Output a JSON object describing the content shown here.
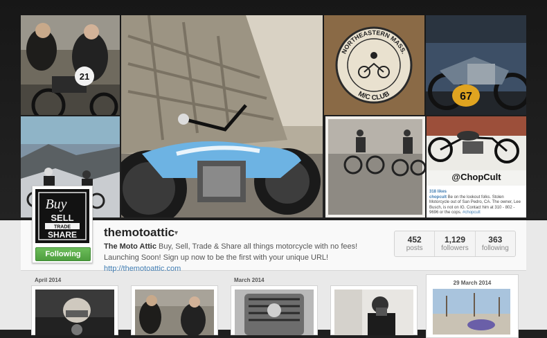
{
  "profile": {
    "username": "themotoattic",
    "display_name": "The Moto Attic",
    "bio": " Buy, Sell, Trade & Share all things motorcycle with no fees! Launching Soon! Sign up now to be the first with your unique URL! ",
    "url": "http://themotoattic.com",
    "follow_label": "Following",
    "avatar_text": {
      "buy": "Buy",
      "sell": "SELL",
      "trade": "TRADE",
      "share": "SHARE"
    }
  },
  "stats": [
    {
      "value": "452",
      "label": "posts"
    },
    {
      "value": "1,129",
      "label": "followers"
    },
    {
      "value": "363",
      "label": "following"
    }
  ],
  "cover": {
    "badge_text": {
      "top": "NORTHEASTERN MASS.",
      "bottom": "M/C CLUB"
    },
    "race_number_1": "21",
    "race_number_2": "67",
    "chopcult": {
      "handle_overlay": "@ChopCult",
      "likes": "318 likes",
      "user": "chopcult",
      "caption": " Be on the lookout folks. Stolen Motorcycle out of San Pedro, CA. The owner, Lee Busch, is not on IG. Contact him at 310 - 802 - 9696 or the cops. ",
      "hashtag": "#chopcult"
    }
  },
  "timeline": {
    "month_1": "April 2014",
    "month_2": "March 2014",
    "date_card": "29 March 2014"
  },
  "colors": {
    "follow_green": "#4e9e3f",
    "link_blue": "#3e7bb1",
    "background_dark": "#1f1f1f",
    "background_light": "#e9e9e9"
  }
}
